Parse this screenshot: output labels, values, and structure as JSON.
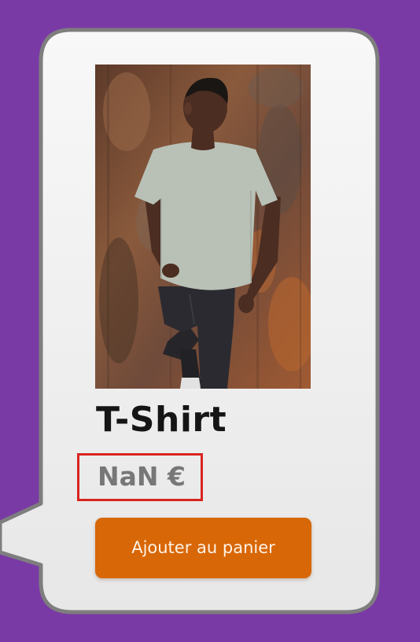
{
  "product": {
    "name": "T-Shirt",
    "price": "NaN €",
    "image_alt": "Man leaning against a rusty wall wearing a light grey t-shirt and dark jeans"
  },
  "actions": {
    "add_to_cart_label": "Ajouter au panier"
  },
  "colors": {
    "background": "#7a3aa6",
    "card": "#f7f7f7",
    "card_border": "#7e7e7e",
    "button": "#d86707",
    "highlight_border": "#d8251f",
    "price_text": "#777777"
  }
}
